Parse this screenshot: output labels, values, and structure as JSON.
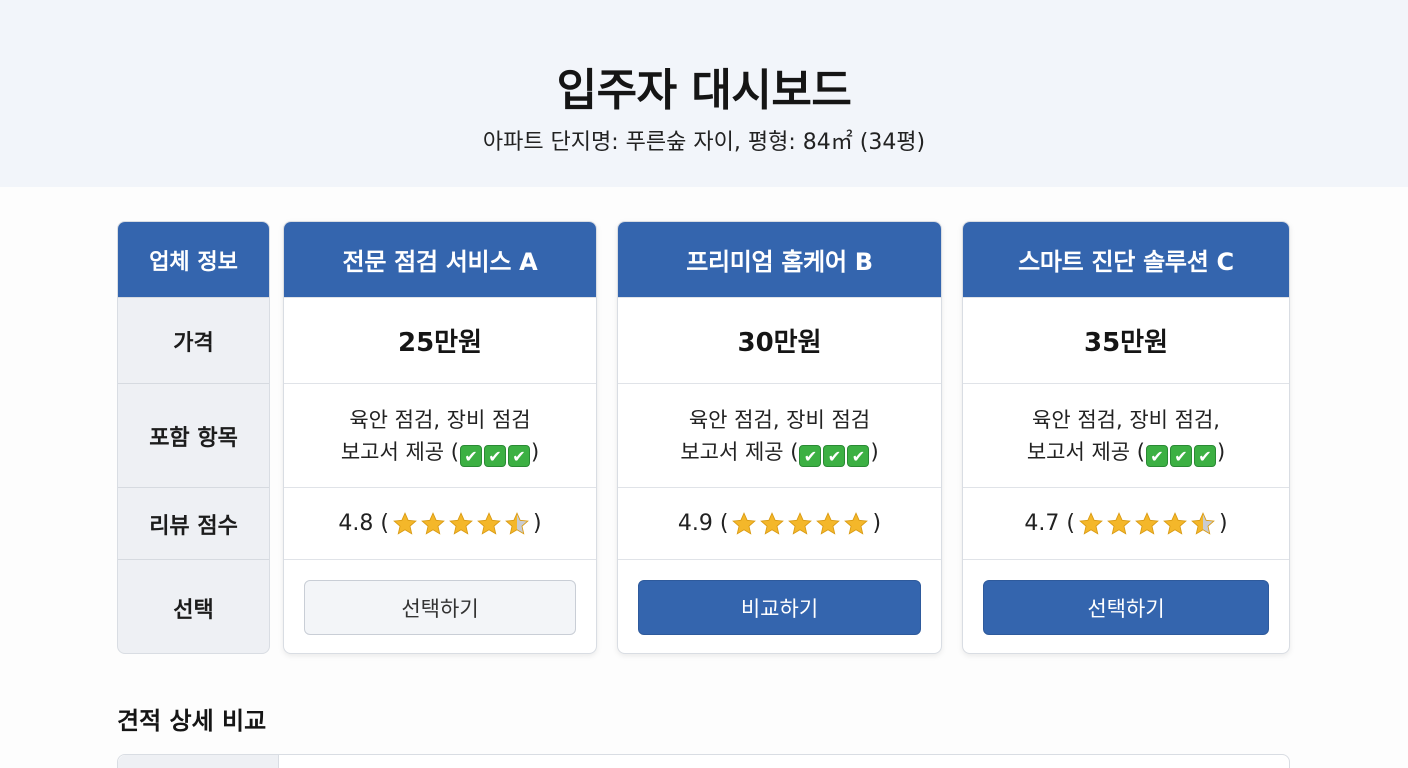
{
  "header": {
    "title": "입주자 대시보드",
    "subtitle": "아파트 단지명: 푸른숲 자이, 평형: 84㎡ (34평)"
  },
  "labels": {
    "head": "업체 정보",
    "price": "가격",
    "items": "포함 항목",
    "review": "리뷰 점수",
    "select": "선택"
  },
  "vendors": [
    {
      "name": "전문 점검 서비스 A",
      "price": "25만원",
      "items_line1": "육안 점검, 장비 점검",
      "items_line2": "보고서 제공 (",
      "items_close": ")",
      "checks": [
        "✔",
        "✔",
        "✔"
      ],
      "score": "4.8 (",
      "score_close": ")",
      "rating": 4.5,
      "button": "선택하기",
      "button_style": "outline"
    },
    {
      "name": "프리미엄 홈케어 B",
      "price": "30만원",
      "items_line1": "육안 점검, 장비 점검",
      "items_line2": "보고서 제공 (",
      "items_close": ")",
      "checks": [
        "✔",
        "✔",
        "✔"
      ],
      "score": "4.9 (",
      "score_close": ")",
      "rating": 5,
      "button": "비교하기",
      "button_style": "fill"
    },
    {
      "name": "스마트 진단 솔루션 C",
      "price": "35만원",
      "items_line1": "육안 점검, 장비 점검,",
      "items_line2": "보고서 제공 (",
      "items_close": ")",
      "checks": [
        "✔",
        "✔",
        "✔"
      ],
      "score": "4.7 (",
      "score_close": ")",
      "rating": 4.5,
      "button": "선택하기",
      "button_style": "fill"
    }
  ],
  "detail": {
    "title": "견적 상세 비교"
  },
  "colors": {
    "accent": "#3465ae",
    "star": "#f4b72a",
    "star_empty": "#c9ccd2",
    "check": "#3cb043"
  }
}
